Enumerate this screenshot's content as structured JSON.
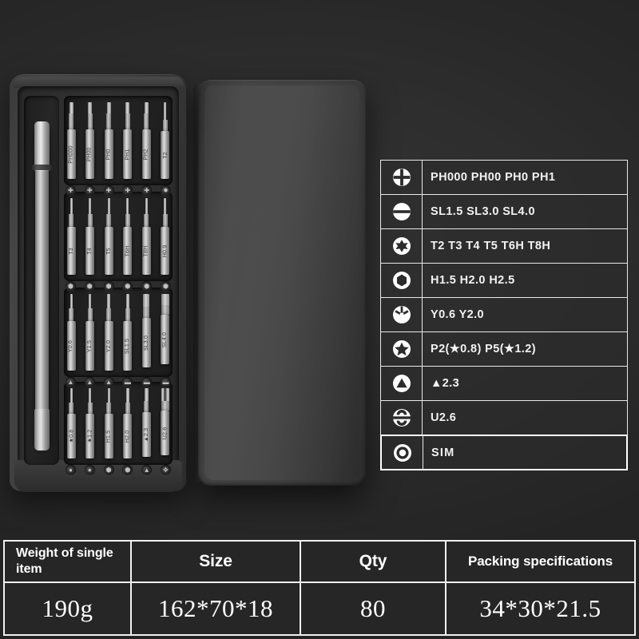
{
  "product": {
    "name": "precision-screwdriver-bit-set",
    "case_color": "#3c3c3c",
    "accent_color": "#ffffff",
    "background_color": "#2b2b2b",
    "handle_label": "",
    "bit_rows": [
      {
        "labels": [
          "PH000",
          "PH00",
          "PH0",
          "PH1",
          "PH2",
          "T2"
        ],
        "sockets": [
          "+",
          "+",
          "+",
          "+",
          "+",
          "✶"
        ]
      },
      {
        "labels": [
          "T3",
          "T4",
          "T5",
          "T6H",
          "T8H",
          "H0.9"
        ],
        "sockets": [
          "⬡",
          "⬡",
          "⬡",
          "⬡",
          "⬡",
          "⬡"
        ]
      },
      {
        "labels": [
          "Y0.6",
          "Y1.5",
          "Y2.0",
          "SL1.5",
          "SL3.0",
          "SL4.0"
        ],
        "sockets": [
          "▲",
          "▲",
          "▲",
          "—",
          "—",
          "—"
        ]
      },
      {
        "labels": [
          "★0.8",
          "★1.2",
          "H1.5",
          "H2.0",
          "▲2.3",
          "U2.6"
        ],
        "sockets": [
          "●",
          "●",
          "⬡",
          "⬡",
          "▲",
          "⚖"
        ]
      }
    ]
  },
  "spec_table": {
    "name": "bit-specification-table",
    "rows": [
      {
        "icon": "phillips-icon",
        "label": "PH000 PH00 PH0 PH1",
        "highlight": false
      },
      {
        "icon": "slotted-icon",
        "label": "SL1.5 SL3.0 SL4.0",
        "highlight": false
      },
      {
        "icon": "torx-icon",
        "label": "T2 T3 T4 T5 T6H T8H",
        "highlight": false
      },
      {
        "icon": "hex-icon",
        "label": "H1.5 H2.0  H2.5",
        "highlight": false
      },
      {
        "icon": "tri-wing-icon",
        "label": "Y0.6 Y2.0",
        "highlight": false
      },
      {
        "icon": "pentalobe-icon",
        "label": "P2(★0.8) P5(★1.2)",
        "highlight": false
      },
      {
        "icon": "triangle-icon",
        "label": "▲2.3",
        "highlight": false
      },
      {
        "icon": "u-shape-icon",
        "label": "U2.6",
        "highlight": false
      },
      {
        "icon": "sim-icon",
        "label": "SIM",
        "highlight": true
      }
    ]
  },
  "bottom_table": {
    "name": "packing-specification-table",
    "headers": [
      "Weight of single item",
      "Size",
      "Qty",
      "Packing specifications"
    ],
    "values": [
      "190g",
      "162*70*18",
      "80",
      "34*30*21.5"
    ]
  }
}
